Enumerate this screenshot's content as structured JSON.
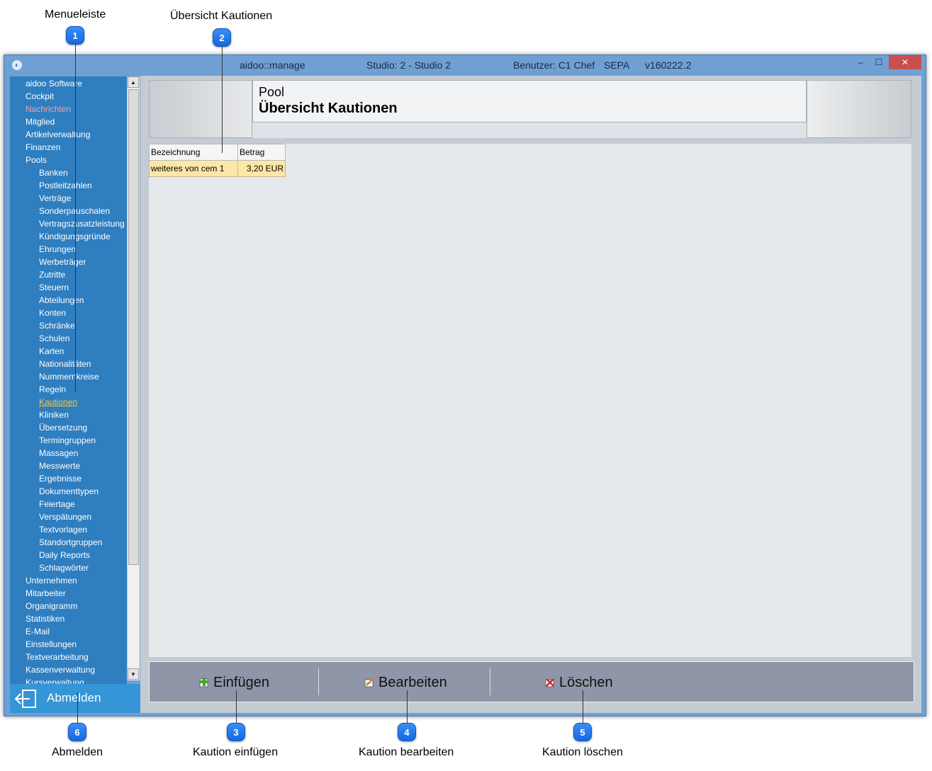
{
  "callouts": [
    {
      "num": "1",
      "label": "Menueleiste"
    },
    {
      "num": "2",
      "label": "Übersicht Kautionen"
    },
    {
      "num": "3",
      "label": "Kaution einfügen"
    },
    {
      "num": "4",
      "label": "Kaution bearbeiten"
    },
    {
      "num": "5",
      "label": "Kaution löschen"
    },
    {
      "num": "6",
      "label": "Abmelden"
    }
  ],
  "window": {
    "app_name": "aidoo::manage",
    "studio": "Studio: 2 - Studio 2",
    "user": "Benutzer: C1 Chef",
    "sepa": "SEPA",
    "version": "v160222.2",
    "minimize": "–",
    "maximize": "☐",
    "close": "✕"
  },
  "sidebar": {
    "items": [
      {
        "label": "aidoo Software",
        "level": 1,
        "state": "normal"
      },
      {
        "label": "Cockpit",
        "level": 1,
        "state": "normal"
      },
      {
        "label": "Nachrichten",
        "level": 1,
        "state": "highlight"
      },
      {
        "label": "Mitglied",
        "level": 1,
        "state": "normal"
      },
      {
        "label": "Artikelverwaltung",
        "level": 1,
        "state": "normal"
      },
      {
        "label": "Finanzen",
        "level": 1,
        "state": "normal"
      },
      {
        "label": "Pools",
        "level": 1,
        "state": "normal"
      },
      {
        "label": "Banken",
        "level": 2,
        "state": "normal"
      },
      {
        "label": "Postleitzahlen",
        "level": 2,
        "state": "normal"
      },
      {
        "label": "Verträge",
        "level": 2,
        "state": "normal"
      },
      {
        "label": "Sonderpauschalen",
        "level": 2,
        "state": "normal"
      },
      {
        "label": "Vertragszusatzleistung",
        "level": 2,
        "state": "normal"
      },
      {
        "label": "Kündigungsgründe",
        "level": 2,
        "state": "normal"
      },
      {
        "label": "Ehrungen",
        "level": 2,
        "state": "normal"
      },
      {
        "label": "Werbeträger",
        "level": 2,
        "state": "normal"
      },
      {
        "label": "Zutritte",
        "level": 2,
        "state": "normal"
      },
      {
        "label": "Steuern",
        "level": 2,
        "state": "normal"
      },
      {
        "label": "Abteilungen",
        "level": 2,
        "state": "normal"
      },
      {
        "label": "Konten",
        "level": 2,
        "state": "normal"
      },
      {
        "label": "Schränke",
        "level": 2,
        "state": "normal"
      },
      {
        "label": "Schulen",
        "level": 2,
        "state": "normal"
      },
      {
        "label": "Karten",
        "level": 2,
        "state": "normal"
      },
      {
        "label": "Nationalitäten",
        "level": 2,
        "state": "normal"
      },
      {
        "label": "Nummernkreise",
        "level": 2,
        "state": "normal"
      },
      {
        "label": "Regeln",
        "level": 2,
        "state": "normal"
      },
      {
        "label": "Kautionen",
        "level": 2,
        "state": "active"
      },
      {
        "label": "Kliniken",
        "level": 2,
        "state": "normal"
      },
      {
        "label": "Übersetzung",
        "level": 2,
        "state": "normal"
      },
      {
        "label": "Termingruppen",
        "level": 2,
        "state": "normal"
      },
      {
        "label": "Massagen",
        "level": 2,
        "state": "normal"
      },
      {
        "label": "Messwerte",
        "level": 2,
        "state": "normal"
      },
      {
        "label": "Ergebnisse",
        "level": 2,
        "state": "normal"
      },
      {
        "label": "Dokumenttypen",
        "level": 2,
        "state": "normal"
      },
      {
        "label": "Feiertage",
        "level": 2,
        "state": "normal"
      },
      {
        "label": "Verspätungen",
        "level": 2,
        "state": "normal"
      },
      {
        "label": "Textvorlagen",
        "level": 2,
        "state": "normal"
      },
      {
        "label": "Standortgruppen",
        "level": 2,
        "state": "normal"
      },
      {
        "label": "Daily Reports",
        "level": 2,
        "state": "normal"
      },
      {
        "label": "Schlagwörter",
        "level": 2,
        "state": "normal"
      },
      {
        "label": "Unternehmen",
        "level": 1,
        "state": "normal"
      },
      {
        "label": "Mitarbeiter",
        "level": 1,
        "state": "normal"
      },
      {
        "label": "Organigramm",
        "level": 1,
        "state": "normal"
      },
      {
        "label": "Statistiken",
        "level": 1,
        "state": "normal"
      },
      {
        "label": "E-Mail",
        "level": 1,
        "state": "normal"
      },
      {
        "label": "Einstellungen",
        "level": 1,
        "state": "normal"
      },
      {
        "label": "Textverarbeitung",
        "level": 1,
        "state": "normal"
      },
      {
        "label": "Kassenverwaltung",
        "level": 1,
        "state": "normal"
      },
      {
        "label": "Kursverwaltung",
        "level": 1,
        "state": "normal"
      }
    ],
    "logout_label": "Abmelden",
    "logout_icon": "arrow-left-icon"
  },
  "header": {
    "kicker": "Pool",
    "title": "Übersicht Kautionen"
  },
  "table": {
    "columns": [
      "Bezeichnung",
      "Betrag"
    ],
    "rows": [
      [
        "weiteres von cem 1",
        "3,20 EUR"
      ]
    ]
  },
  "toolbar": {
    "insert_label": "Einfügen",
    "edit_label": "Bearbeiten",
    "delete_label": "Löschen",
    "insert_icon": "add-icon",
    "edit_icon": "edit-icon",
    "delete_icon": "delete-icon"
  },
  "colors": {
    "sidebar": "#2e7ec0",
    "active_item": "#f2c94c",
    "highlight_item": "#f0a0a8",
    "selected_row": "#fce7a6",
    "badge": "#1668e0"
  }
}
